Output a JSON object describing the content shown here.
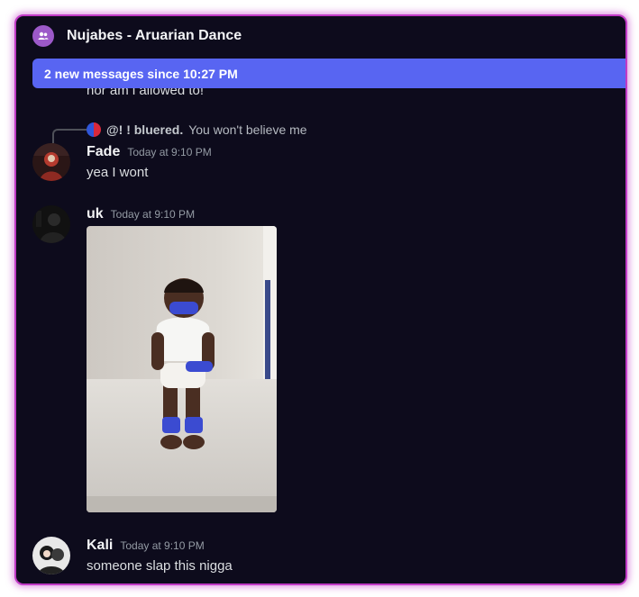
{
  "header": {
    "channel_icon": "group-dm-icon",
    "title": "Nujabes - Aruarian Dance"
  },
  "new_messages_bar": {
    "text": "2 new messages since 10:27 PM",
    "color": "#5865f2"
  },
  "partial_message": {
    "text": "nor am i allowed to!"
  },
  "messages": [
    {
      "author": "Fade",
      "timestamp": "Today at 9:10 PM",
      "text": "yea I wont",
      "reply": {
        "author": "@! ! bluered.",
        "text": "You won't believe me"
      }
    },
    {
      "author": "uk",
      "timestamp": "Today at 9:10 PM",
      "attachment": "image-attachment"
    },
    {
      "author": "Kali",
      "timestamp": "Today at 9:10 PM",
      "text": "someone slap this nigga"
    }
  ],
  "colors": {
    "background": "#0d0b1c",
    "border": "#c13ac6",
    "text": "#dbdee1",
    "muted": "#949ba4"
  }
}
